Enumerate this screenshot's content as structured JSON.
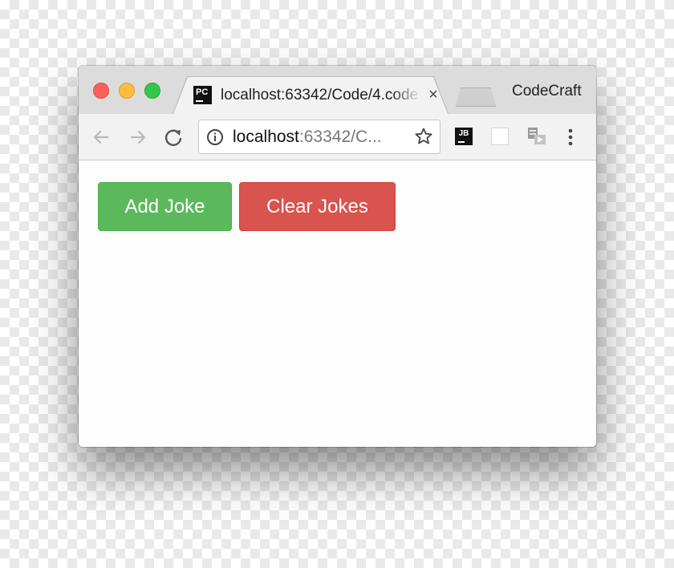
{
  "browser": {
    "tab": {
      "favicon_text": "PC",
      "title": "localhost:63342/Code/4.code",
      "close_label": "×"
    },
    "profile_name": "CodeCraft",
    "address_bar": {
      "host": "localhost",
      "path": ":63342/C..."
    },
    "extensions": {
      "jetbrains_label": "JB"
    },
    "icons": [
      "back-arrow-icon",
      "forward-arrow-icon",
      "reload-icon",
      "info-icon",
      "star-icon",
      "jetbrains-extension-icon",
      "blank-extension-icon",
      "cast-extension-icon",
      "menu-dots-icon"
    ]
  },
  "page": {
    "buttons": {
      "add_label": "Add Joke",
      "clear_label": "Clear Jokes"
    }
  },
  "colors": {
    "add_button": "#5cb85c",
    "clear_button": "#d9534f",
    "close_light": "#fc605b",
    "minimize_light": "#fdbc40",
    "maximize_light": "#34c84a"
  }
}
